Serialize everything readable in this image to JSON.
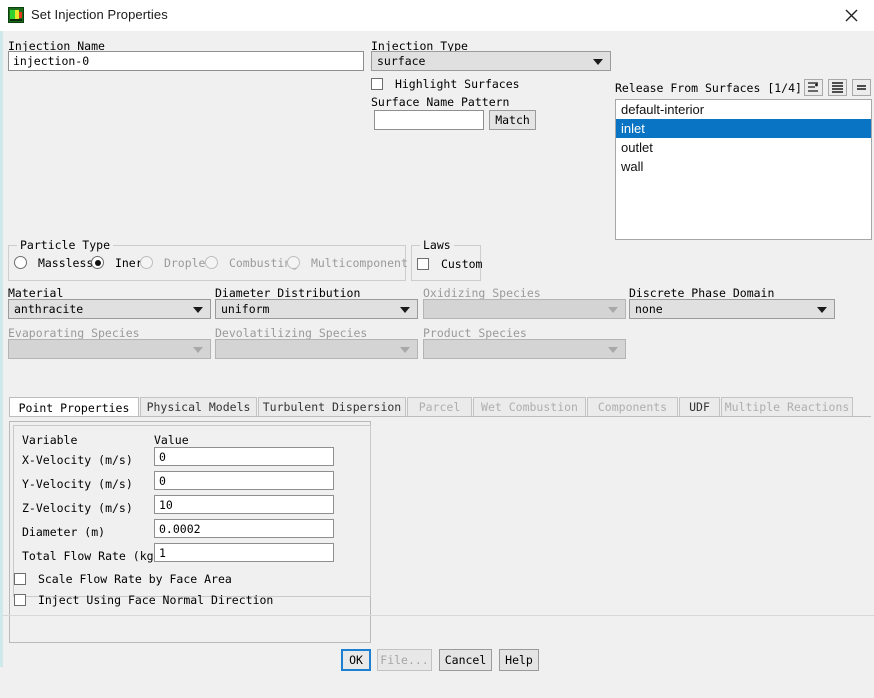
{
  "window": {
    "title": "Set Injection Properties",
    "app_icon": "fluent-icon",
    "close_icon": "close-icon"
  },
  "injection_name": {
    "label": "Injection Name",
    "value": "injection-0"
  },
  "injection_type": {
    "label": "Injection Type",
    "value": "surface"
  },
  "highlight_surfaces": {
    "label": "Highlight Surfaces",
    "checked": false
  },
  "surface_name_pattern": {
    "label": "Surface Name Pattern",
    "value": "",
    "match_button": "Match"
  },
  "release_from_surfaces": {
    "label": "Release From Surfaces [1/4]",
    "icons": [
      "filter-list-icon",
      "list-view-icon",
      "equal-size-icon"
    ],
    "items": [
      {
        "label": "default-interior",
        "selected": false
      },
      {
        "label": "inlet",
        "selected": true
      },
      {
        "label": "outlet",
        "selected": false
      },
      {
        "label": "wall",
        "selected": false
      }
    ]
  },
  "particle_type": {
    "label": "Particle Type",
    "options": [
      {
        "label": "Massless",
        "selected": false,
        "disabled": false
      },
      {
        "label": "Inert",
        "selected": true,
        "disabled": false
      },
      {
        "label": "Droplet",
        "selected": false,
        "disabled": true
      },
      {
        "label": "Combusting",
        "selected": false,
        "disabled": true
      },
      {
        "label": "Multicomponent",
        "selected": false,
        "disabled": true
      }
    ]
  },
  "laws": {
    "label": "Laws",
    "custom": {
      "label": "Custom",
      "checked": false
    }
  },
  "material": {
    "label": "Material",
    "value": "anthracite",
    "disabled": false
  },
  "diameter_distribution": {
    "label": "Diameter Distribution",
    "value": "uniform",
    "disabled": false
  },
  "oxidizing_species": {
    "label": "Oxidizing Species",
    "value": "",
    "disabled": true
  },
  "discrete_phase_domain": {
    "label": "Discrete Phase Domain",
    "value": "none",
    "disabled": false
  },
  "evaporating_species": {
    "label": "Evaporating Species",
    "value": "",
    "disabled": true
  },
  "devolatilizing_species": {
    "label": "Devolatilizing Species",
    "value": "",
    "disabled": true
  },
  "product_species": {
    "label": "Product Species",
    "value": "",
    "disabled": true
  },
  "tabs": [
    {
      "label": "Point Properties",
      "active": true,
      "disabled": false
    },
    {
      "label": "Physical Models",
      "active": false,
      "disabled": false
    },
    {
      "label": "Turbulent Dispersion",
      "active": false,
      "disabled": false
    },
    {
      "label": "Parcel",
      "active": false,
      "disabled": true
    },
    {
      "label": "Wet Combustion",
      "active": false,
      "disabled": true
    },
    {
      "label": "Components",
      "active": false,
      "disabled": true
    },
    {
      "label": "UDF",
      "active": false,
      "disabled": false
    },
    {
      "label": "Multiple Reactions",
      "active": false,
      "disabled": true
    }
  ],
  "point_properties": {
    "column_variable": "Variable",
    "column_value": "Value",
    "rows": [
      {
        "variable": "X-Velocity (m/s)",
        "value": "0"
      },
      {
        "variable": "Y-Velocity (m/s)",
        "value": "0"
      },
      {
        "variable": "Z-Velocity (m/s)",
        "value": "10"
      },
      {
        "variable": "Diameter (m)",
        "value": "0.0002"
      },
      {
        "variable": "Total Flow Rate (kg/s)",
        "value": "1"
      }
    ]
  },
  "options": [
    {
      "label": "Scale Flow Rate by Face Area",
      "checked": false
    },
    {
      "label": "Inject Using Face Normal Direction",
      "checked": false
    }
  ],
  "buttons": [
    {
      "label": "OK",
      "disabled": false,
      "focused": true
    },
    {
      "label": "File...",
      "disabled": true,
      "focused": false
    },
    {
      "label": "Cancel",
      "disabled": false,
      "focused": false
    },
    {
      "label": "Help",
      "disabled": false,
      "focused": false
    }
  ],
  "colors": {
    "selection": "#0a74c4",
    "focus": "#1d7fd0",
    "accent_edge": "#cfe9ea"
  }
}
